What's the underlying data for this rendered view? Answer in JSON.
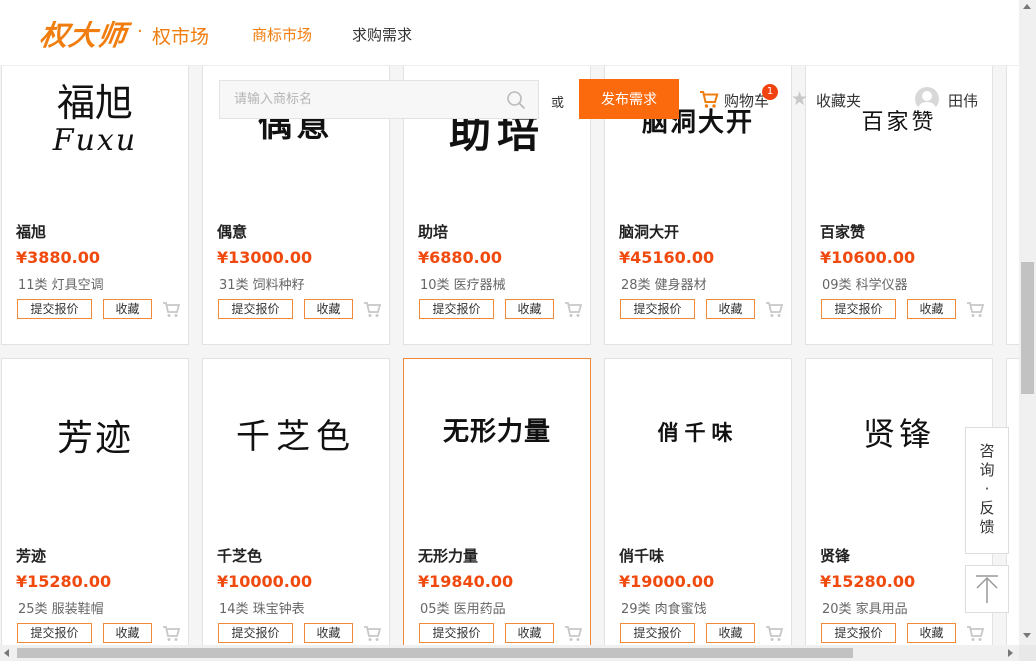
{
  "header": {
    "logo_text": "权大师",
    "logo_dot": "·",
    "logo_sub": "权市场",
    "nav": [
      {
        "label": "商标市场",
        "active": true
      },
      {
        "label": "求购需求",
        "active": false
      }
    ]
  },
  "toolbar": {
    "search_placeholder": "请输入商标名",
    "or_text": "或",
    "publish_label": "发布需求",
    "cart_label": "购物车",
    "cart_count": "1",
    "favorites_label": "收藏夹",
    "user_name": "田伟"
  },
  "card_actions": {
    "quote_label": "提交报价",
    "collect_label": "收藏"
  },
  "row1": [
    {
      "mark_line1": "福旭",
      "mark_line2": "Fuxu",
      "name": "福旭",
      "price": "¥3880.00",
      "class": "11类 灯具空调"
    },
    {
      "mark_line1": "偶意",
      "name": "偶意",
      "price": "¥13000.00",
      "class": "31类 饲料种籽"
    },
    {
      "mark_line1": "助培",
      "name": "助培",
      "price": "¥6880.00",
      "class": "10类 医疗器械"
    },
    {
      "mark_line1": "脑洞大开",
      "name": "脑洞大开",
      "price": "¥45160.00",
      "class": "28类 健身器材"
    },
    {
      "mark_line1": "百家赞",
      "name": "百家赞",
      "price": "¥10600.00",
      "class": "09类 科学仪器"
    }
  ],
  "row2": [
    {
      "mark_line1": "芳迹",
      "name": "芳迹",
      "price": "¥15280.00",
      "class": "25类 服装鞋帽"
    },
    {
      "mark_line1": "千芝色",
      "name": "千芝色",
      "price": "¥10000.00",
      "class": "14类 珠宝钟表"
    },
    {
      "mark_line1": "无形力量",
      "name": "无形力量",
      "price": "¥19840.00",
      "class": "05类 医用药品"
    },
    {
      "mark_line1": "俏千味",
      "name": "俏千味",
      "price": "¥19000.00",
      "class": "29类 肉食蜜饯"
    },
    {
      "mark_line1": "贤锋",
      "name": "贤锋",
      "price": "¥15280.00",
      "class": "20类 家具用品"
    }
  ],
  "side": {
    "consult_label": "咨询·反馈"
  },
  "colors": {
    "brand_orange": "#f07d0e",
    "publish_button": "#fb6a0c",
    "price_red": "#f04a0f"
  }
}
